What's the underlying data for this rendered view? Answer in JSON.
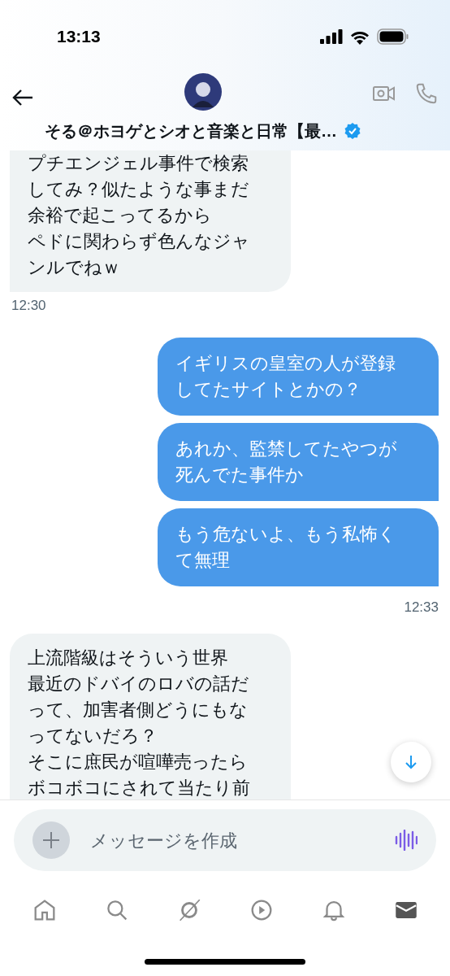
{
  "status_bar": {
    "time": "13:13"
  },
  "header": {
    "name": "そる＠ホヨゲとシオと音楽と日常【最…",
    "verified": true
  },
  "messages": [
    {
      "kind": "received",
      "paragraphs": [
        "プチエンジェル事件で検索してみ？似たような事まだ余裕で起こってるから",
        "ペドに関わらず色んなジャンルでねｗ"
      ]
    },
    {
      "kind": "timestamp",
      "text": "12:30"
    },
    {
      "kind": "sent",
      "paragraphs": [
        "イギリスの皇室の人が登録してたサイトとかの？"
      ]
    },
    {
      "kind": "sent",
      "paragraphs": [
        "あれか、監禁してたやつが死んでた事件か"
      ]
    },
    {
      "kind": "sent",
      "paragraphs": [
        "もう危ないよ、もう私怖くて無理"
      ]
    },
    {
      "kind": "timestamp",
      "text": "12:33"
    },
    {
      "kind": "received",
      "paragraphs": [
        "上流階級はそういう世界",
        "最近のドバイのロバの話だって、加害者側どうにもなってないだろ？",
        "そこに庶民が喧嘩売ったらボコボコにされて当たり前"
      ]
    }
  ],
  "composer": {
    "placeholder": "メッセージを作成"
  },
  "tab_bar": [
    {
      "kind": "home",
      "selected": false
    },
    {
      "kind": "search",
      "selected": false
    },
    {
      "kind": "grok",
      "selected": false
    },
    {
      "kind": "video",
      "selected": false
    },
    {
      "kind": "bell",
      "selected": false
    },
    {
      "kind": "mail",
      "selected": true
    }
  ]
}
